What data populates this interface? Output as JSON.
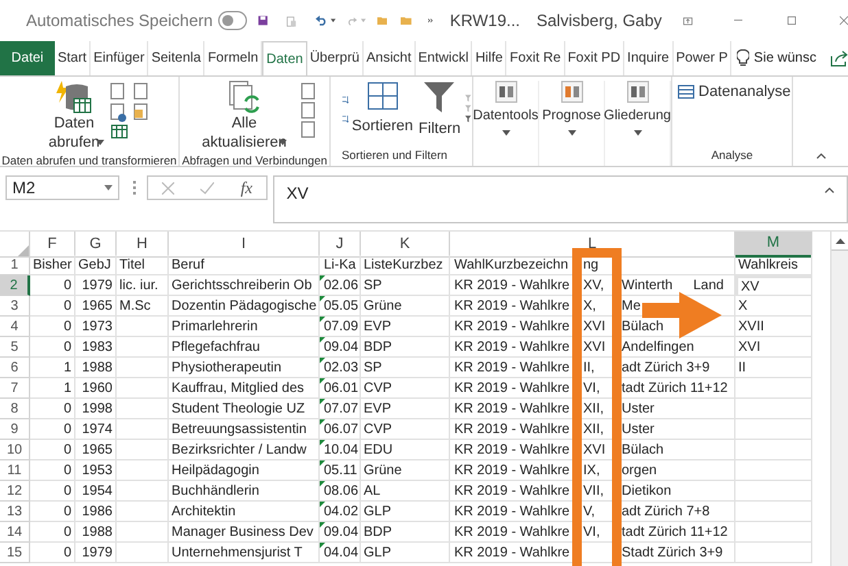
{
  "title_bar": {
    "autosave_label": "Automatisches Speichern",
    "autosave_on": false,
    "file_name": "KRW19...",
    "user": "Salvisberg, Gaby"
  },
  "tabs": [
    {
      "label": "Datei",
      "kind": "file",
      "selected": false
    },
    {
      "label": "Start",
      "kind": "tab",
      "selected": false
    },
    {
      "label": "Einfüger",
      "kind": "tab",
      "selected": false
    },
    {
      "label": "Seitenla",
      "kind": "tab",
      "selected": false
    },
    {
      "label": "Formeln",
      "kind": "tab",
      "selected": false
    },
    {
      "label": "Daten",
      "kind": "tab",
      "selected": true
    },
    {
      "label": "Überprü",
      "kind": "tab",
      "selected": false
    },
    {
      "label": "Ansicht",
      "kind": "tab",
      "selected": false
    },
    {
      "label": "Entwickl",
      "kind": "tab",
      "selected": false
    },
    {
      "label": "Hilfe",
      "kind": "tab",
      "selected": false
    },
    {
      "label": "Foxit Re",
      "kind": "tab",
      "selected": false
    },
    {
      "label": "Foxit PD",
      "kind": "tab",
      "selected": false
    },
    {
      "label": "Inquire",
      "kind": "tab",
      "selected": false
    },
    {
      "label": "Power P",
      "kind": "tab",
      "selected": false
    }
  ],
  "tell_me": "Sie wünsc",
  "ribbon": {
    "groups": [
      {
        "label": "Daten abrufen und transformieren",
        "buttons": [
          [
            "Daten",
            "abrufen"
          ]
        ]
      },
      {
        "label": "Abfragen und Verbindungen",
        "buttons": [
          [
            "Alle",
            "aktualisieren"
          ]
        ]
      },
      {
        "label": "Sortieren und Filtern",
        "buttons": [
          [
            "Sortieren"
          ],
          [
            "Filtern"
          ]
        ]
      },
      {
        "buttons": [
          [
            "Datentools"
          ],
          [
            "Prognose"
          ],
          [
            "Gliederung"
          ]
        ]
      },
      {
        "label": "Analyse",
        "buttons": [
          [
            "Datenanalyse"
          ]
        ]
      }
    ]
  },
  "name_box": "M2",
  "function_button": "fx",
  "formula": "XV",
  "columns": [
    {
      "label": "F",
      "selected": false
    },
    {
      "label": "G",
      "selected": false
    },
    {
      "label": "H",
      "selected": false
    },
    {
      "label": "I",
      "selected": false
    },
    {
      "label": "J",
      "selected": false
    },
    {
      "label": "K",
      "selected": false
    },
    {
      "label": "L",
      "selected": false
    },
    {
      "label": "M",
      "selected": true
    }
  ],
  "rows": [
    {
      "row": "1",
      "bisher": "Bisher",
      "gebj": "GebJ",
      "titel": "Titel",
      "beruf": "Beruf",
      "lika": "Li-Ka",
      "liste": "ListeKurzbez",
      "wahl_pre": "WahlKurzbezeichn",
      "wahl_mid": "ng",
      "wahl_post": "",
      "wahlkreis": "Wahlkreis",
      "selected": false
    },
    {
      "row": "2",
      "bisher": "0",
      "gebj": "1979",
      "titel": "lic. iur.",
      "beruf": "Gerichtsschreiberin Ob",
      "lika": "02.06",
      "liste": "SP",
      "wahl_pre": "KR 2019 - Wahlkre",
      "wahl_mid": "XV,",
      "wahl_post": "Winterth",
      "wahl_tail": "Land",
      "wahlkreis": "XV",
      "selected": true,
      "flag": true
    },
    {
      "row": "3",
      "bisher": "0",
      "gebj": "1965",
      "titel": "M.Sc",
      "beruf": "Dozentin Pädagogische",
      "lika": "05.05",
      "liste": "Grüne",
      "wahl_pre": "KR 2019 - Wahlkre",
      "wahl_mid": "X,",
      "wahl_post": "Me",
      "wahlkreis": "X",
      "selected": false,
      "flag": true
    },
    {
      "row": "4",
      "bisher": "0",
      "gebj": "1973",
      "titel": "",
      "beruf": "Primarlehrerin",
      "lika": "07.09",
      "liste": "EVP",
      "wahl_pre": "KR 2019 - Wahlkre",
      "wahl_mid": "XVI",
      "wahl_post": "Bülach",
      "wahlkreis": "XVII",
      "selected": false,
      "flag": true
    },
    {
      "row": "5",
      "bisher": "0",
      "gebj": "1983",
      "titel": "",
      "beruf": "Pflegefachfrau",
      "lika": "09.04",
      "liste": "BDP",
      "wahl_pre": "KR 2019 - Wahlkre",
      "wahl_mid": "XVI",
      "wahl_post": "Andelfingen",
      "wahlkreis": "XVI",
      "selected": false,
      "flag": true
    },
    {
      "row": "6",
      "bisher": "1",
      "gebj": "1988",
      "titel": "",
      "beruf": "Physiotherapeutin",
      "lika": "02.03",
      "liste": "SP",
      "wahl_pre": "KR 2019 - Wahlkre",
      "wahl_mid": "II,",
      "wahl_post": "adt Zürich 3+9",
      "wahlkreis": "II",
      "selected": false,
      "flag": true
    },
    {
      "row": "7",
      "bisher": "1",
      "gebj": "1960",
      "titel": "",
      "beruf": "Kauffrau, Mitglied des",
      "lika": "06.01",
      "liste": "CVP",
      "wahl_pre": "KR 2019 - Wahlkre",
      "wahl_mid": "VI,",
      "wahl_post": "tadt Zürich 11+12",
      "wahlkreis": "",
      "selected": false,
      "flag": true
    },
    {
      "row": "8",
      "bisher": "0",
      "gebj": "1998",
      "titel": "",
      "beruf": "Student Theologie UZ",
      "lika": "07.07",
      "liste": "EVP",
      "wahl_pre": "KR 2019 - Wahlkre",
      "wahl_mid": "XII,",
      "wahl_post": "Uster",
      "wahlkreis": "",
      "selected": false,
      "flag": true
    },
    {
      "row": "9",
      "bisher": "0",
      "gebj": "1974",
      "titel": "",
      "beruf": "Betreuungsassistentin",
      "lika": "06.07",
      "liste": "CVP",
      "wahl_pre": "KR 2019 - Wahlkre",
      "wahl_mid": "XII,",
      "wahl_post": "Uster",
      "wahlkreis": "",
      "selected": false,
      "flag": true
    },
    {
      "row": "10",
      "bisher": "0",
      "gebj": "1965",
      "titel": "",
      "beruf": "Bezirksrichter / Landw",
      "lika": "10.04",
      "liste": "EDU",
      "wahl_pre": "KR 2019 - Wahlkre",
      "wahl_mid": "XVI",
      "wahl_post": "Bülach",
      "wahlkreis": "",
      "selected": false,
      "flag": true
    },
    {
      "row": "11",
      "bisher": "0",
      "gebj": "1953",
      "titel": "",
      "beruf": "Heilpädagogin",
      "lika": "05.11",
      "liste": "Grüne",
      "wahl_pre": "KR 2019 - Wahlkre",
      "wahl_mid": "IX,",
      "wahl_post": "orgen",
      "wahlkreis": "",
      "selected": false,
      "flag": true
    },
    {
      "row": "12",
      "bisher": "0",
      "gebj": "1954",
      "titel": "",
      "beruf": "Buchhändlerin",
      "lika": "08.06",
      "liste": "AL",
      "wahl_pre": "KR 2019 - Wahlkre",
      "wahl_mid": "VII,",
      "wahl_post": "Dietikon",
      "wahlkreis": "",
      "selected": false,
      "flag": true
    },
    {
      "row": "13",
      "bisher": "0",
      "gebj": "1986",
      "titel": "",
      "beruf": "Architektin",
      "lika": "04.02",
      "liste": "GLP",
      "wahl_pre": "KR 2019 - Wahlkre",
      "wahl_mid": "V,",
      "wahl_post": "adt Zürich 7+8",
      "wahlkreis": "",
      "selected": false,
      "flag": true
    },
    {
      "row": "14",
      "bisher": "0",
      "gebj": "1988",
      "titel": "",
      "beruf": "Manager Business Dev",
      "lika": "09.04",
      "liste": "BDP",
      "wahl_pre": "KR 2019 - Wahlkre",
      "wahl_mid": "VI,",
      "wahl_post": "tadt Zürich 11+12",
      "wahlkreis": "",
      "selected": false,
      "flag": true
    },
    {
      "row": "15",
      "bisher": "0",
      "gebj": "1979",
      "titel": "",
      "beruf": "Unternehmensjurist T",
      "lika": "04.04",
      "liste": "GLP",
      "wahl_pre": "KR 2019 - Wahlkre",
      "wahl_mid": "",
      "wahl_post": "Stadt Zürich 3+9",
      "wahlkreis": "",
      "selected": false,
      "flag": true
    }
  ]
}
